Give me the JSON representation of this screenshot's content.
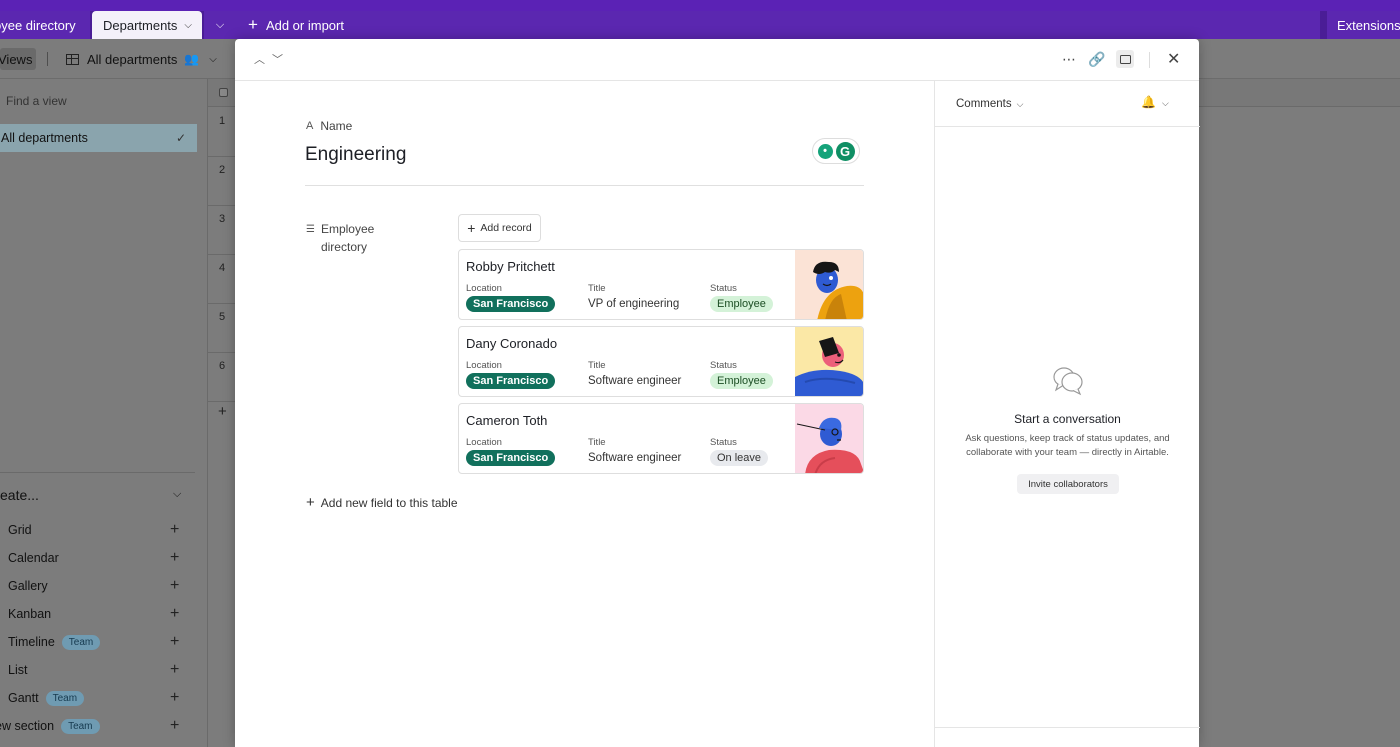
{
  "tabs": {
    "employee": "oyee directory",
    "departments": "Departments",
    "more_icon": "chevron-down-icon",
    "add_import": "Add or import",
    "extensions": "Extensions"
  },
  "toolbar": {
    "views": "Views",
    "all_departments": "All departments"
  },
  "sidebar": {
    "find_placeholder": "Find a view",
    "active_view": "All departments",
    "create_label": "eate...",
    "create_items": [
      {
        "label": "Grid",
        "badge": ""
      },
      {
        "label": "Calendar",
        "badge": ""
      },
      {
        "label": "Gallery",
        "badge": ""
      },
      {
        "label": "Kanban",
        "badge": ""
      },
      {
        "label": "Timeline",
        "badge": "Team"
      },
      {
        "label": "List",
        "badge": ""
      },
      {
        "label": "Gantt",
        "badge": "Team"
      },
      {
        "label": "ew section",
        "badge": "Team"
      }
    ]
  },
  "grid": {
    "row_numbers": [
      "1",
      "2",
      "3",
      "4",
      "5",
      "6"
    ]
  },
  "record": {
    "name_label": "Name",
    "title": "Engineering",
    "field_label": "Employee directory",
    "add_record": "Add record",
    "add_field": "Add new field to this table",
    "cards": [
      {
        "name": "Robby Pritchett",
        "location_label": "Location",
        "location": "San Francisco",
        "title_label": "Title",
        "title": "VP of engineering",
        "status_label": "Status",
        "status": "Employee",
        "avatar_bg": "#fbe3d6"
      },
      {
        "name": "Dany Coronado",
        "location_label": "Location",
        "location": "San Francisco",
        "title_label": "Title",
        "title": "Software engineer",
        "status_label": "Status",
        "status": "Employee",
        "avatar_bg": "#fbe8a6"
      },
      {
        "name": "Cameron Toth",
        "location_label": "Location",
        "location": "San Francisco",
        "title_label": "Title",
        "title": "Software engineer",
        "status_label": "Status",
        "status": "On leave",
        "avatar_bg": "#fbd9e6"
      }
    ]
  },
  "comments": {
    "title": "Comments",
    "start": "Start a conversation",
    "description": "Ask questions, keep track of status updates, and collaborate with your team — directly in Airtable.",
    "invite": "Invite collaborators"
  },
  "colors": {
    "brand_purple": "#5b27b0",
    "location_pill": "#11705c",
    "status_employee": "#d4f2d8",
    "team_badge": "#6f9bb2"
  }
}
